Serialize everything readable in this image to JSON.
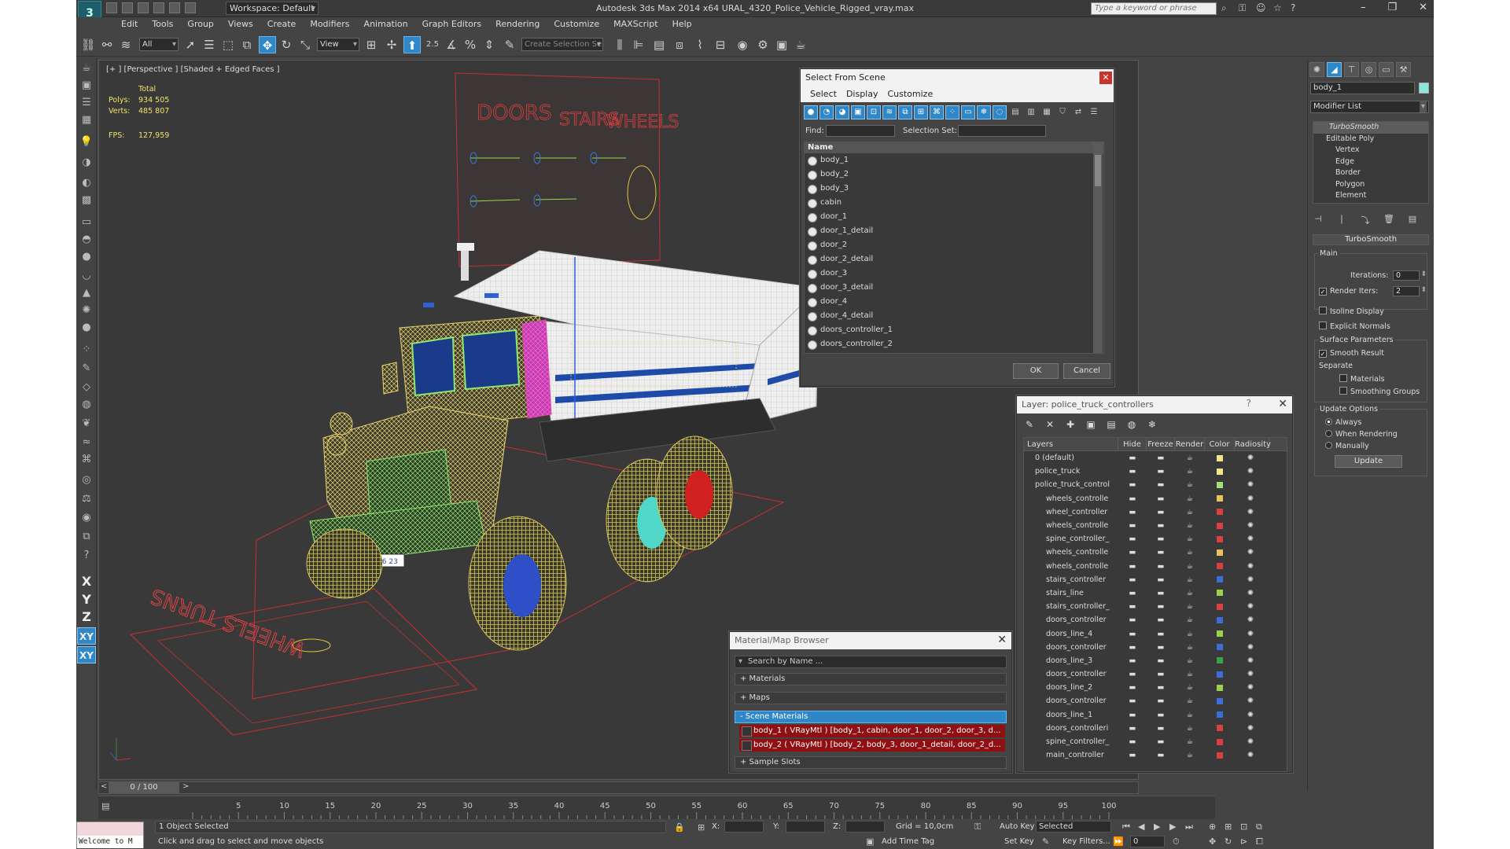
{
  "app": {
    "logo_text": "3",
    "title": "Autodesk 3ds Max  2014 x64     URAL_4320_Police_Vehicle_Rigged_vray.max",
    "workspace": "Workspace: Default",
    "search_placeholder": "Type a keyword or phrase"
  },
  "menu": [
    "Edit",
    "Tools",
    "Group",
    "Views",
    "Create",
    "Modifiers",
    "Animation",
    "Graph Editors",
    "Rendering",
    "Customize",
    "MAXScript",
    "Help"
  ],
  "toolbar": {
    "filter_value": "All",
    "coord_value": "View",
    "selection_set_placeholder": "Create Selection Se",
    "snap_label": "2.5"
  },
  "viewport": {
    "label": "[+ ] [Perspective ] [Shaded + Edged Faces ]",
    "stats": {
      "total_label": "Total",
      "polys_label": "Polys:",
      "polys_value": "934 505",
      "verts_label": "Verts:",
      "verts_value": "485 807",
      "fps_label": "FPS:",
      "fps_value": "127,959"
    },
    "controller_labels": {
      "doors": "DOORS",
      "stairs": "STAIRS",
      "wheels": "WHEELS",
      "wheels_turns": "WHEELS TURNS"
    },
    "plate_text": "M 0216 23"
  },
  "axis_buttons": [
    "X",
    "Y",
    "Z",
    "XY",
    "XY"
  ],
  "command_panel": {
    "object_name": "body_1",
    "object_color": "#87e8de",
    "modifier_list": "Modifier List",
    "stack": {
      "turbosmooth": "TurboSmooth",
      "editable_poly": "Editable Poly",
      "sub": [
        "Vertex",
        "Edge",
        "Border",
        "Polygon",
        "Element"
      ]
    },
    "turbosmooth": {
      "title": "TurboSmooth",
      "main": "Main",
      "iterations_label": "Iterations:",
      "iterations_value": "0",
      "render_iters_label": "Render Iters:",
      "render_iters_value": "2",
      "isoline": "Isoline Display",
      "explicit_normals": "Explicit Normals",
      "surface_params": "Surface Parameters",
      "smooth_result": "Smooth Result",
      "separate": "Separate",
      "materials": "Materials",
      "smoothing_groups": "Smoothing Groups",
      "update_options": "Update Options",
      "always": "Always",
      "when_rendering": "When Rendering",
      "manually": "Manually",
      "update_btn": "Update"
    }
  },
  "select_from_scene": {
    "title": "Select From Scene",
    "menu": [
      "Select",
      "Display",
      "Customize"
    ],
    "find_label": "Find:",
    "selection_set_label": "Selection Set:",
    "column": "Name",
    "items": [
      "body_1",
      "body_2",
      "body_3",
      "cabin",
      "door_1",
      "door_1_detail",
      "door_2",
      "door_2_detail",
      "door_3",
      "door_3_detail",
      "door_4",
      "door_4_detail",
      "doors_controller_1",
      "doors_controller_2"
    ],
    "ok": "OK",
    "cancel": "Cancel"
  },
  "layer_dialog": {
    "title": "Layer: police_truck_controllers",
    "columns": [
      "Layers",
      "Hide",
      "Freeze",
      "Render",
      "Color",
      "Radiosity"
    ],
    "rows": [
      {
        "name": "0 (default)",
        "indent": 1,
        "color": "#f2e58a"
      },
      {
        "name": "police_truck",
        "indent": 1,
        "color": "#f2e58a"
      },
      {
        "name": "police_truck_control",
        "indent": 1,
        "color": "#9ee07a"
      },
      {
        "name": "wheels_controlle",
        "indent": 2,
        "color": "#e8c35a"
      },
      {
        "name": "wheel_controller",
        "indent": 2,
        "color": "#d94040"
      },
      {
        "name": "wheels_controlle",
        "indent": 2,
        "color": "#d94040"
      },
      {
        "name": "spine_controller_",
        "indent": 2,
        "color": "#d94040"
      },
      {
        "name": "wheels_controlle",
        "indent": 2,
        "color": "#e8c35a"
      },
      {
        "name": "wheels_controlle",
        "indent": 2,
        "color": "#d94040"
      },
      {
        "name": "stairs_controller",
        "indent": 2,
        "color": "#3a6fd9"
      },
      {
        "name": "stairs_line",
        "indent": 2,
        "color": "#9bd04a"
      },
      {
        "name": "stairs_controller_",
        "indent": 2,
        "color": "#d94040"
      },
      {
        "name": "doors_controller",
        "indent": 2,
        "color": "#3a6fd9"
      },
      {
        "name": "doors_line_4",
        "indent": 2,
        "color": "#9bd04a"
      },
      {
        "name": "doors_controller",
        "indent": 2,
        "color": "#3a6fd9"
      },
      {
        "name": "doors_line_3",
        "indent": 2,
        "color": "#3aa04a"
      },
      {
        "name": "doors_controller",
        "indent": 2,
        "color": "#3a6fd9"
      },
      {
        "name": "doors_line_2",
        "indent": 2,
        "color": "#9bd04a"
      },
      {
        "name": "doors_controller",
        "indent": 2,
        "color": "#3a6fd9"
      },
      {
        "name": "doors_line_1",
        "indent": 2,
        "color": "#3a6fd9"
      },
      {
        "name": "doors_controlleri",
        "indent": 2,
        "color": "#d94040"
      },
      {
        "name": "spine_controller_",
        "indent": 2,
        "color": "#d94040"
      },
      {
        "name": "main_controller",
        "indent": 2,
        "color": "#d94040"
      }
    ]
  },
  "material_browser": {
    "title": "Material/Map Browser",
    "search": "Search by Name ...",
    "materials": "+ Materials",
    "maps": "+ Maps",
    "scene_materials": "- Scene Materials",
    "items": [
      "body_1  ( VRayMtl )  [body_1, cabin, door_1, door_2, door_3, d...",
      "body_2  ( VRayMtl )  [body_2, body_3, door_1_detail, door_2_d..."
    ],
    "sample_slots": "+ Sample Slots"
  },
  "timeline": {
    "frame": "0 / 100",
    "ticks": [
      "5",
      "10",
      "15",
      "20",
      "25",
      "30",
      "35",
      "40",
      "45",
      "50",
      "55",
      "60",
      "65",
      "70",
      "75",
      "80",
      "85",
      "90",
      "95",
      "100"
    ]
  },
  "status": {
    "maxscript": "Welcome to M",
    "selected": "1 Object Selected",
    "prompt": "Click and drag to select and move objects",
    "x_label": "X:",
    "y_label": "Y:",
    "z_label": "Z:",
    "grid": "Grid = 10,0cm",
    "add_time_tag": "Add Time Tag",
    "auto_key": "Auto Key",
    "set_key": "Set Key",
    "selected_dropdown": "Selected",
    "key_filters": "Key Filters...",
    "frame_value": "0"
  }
}
